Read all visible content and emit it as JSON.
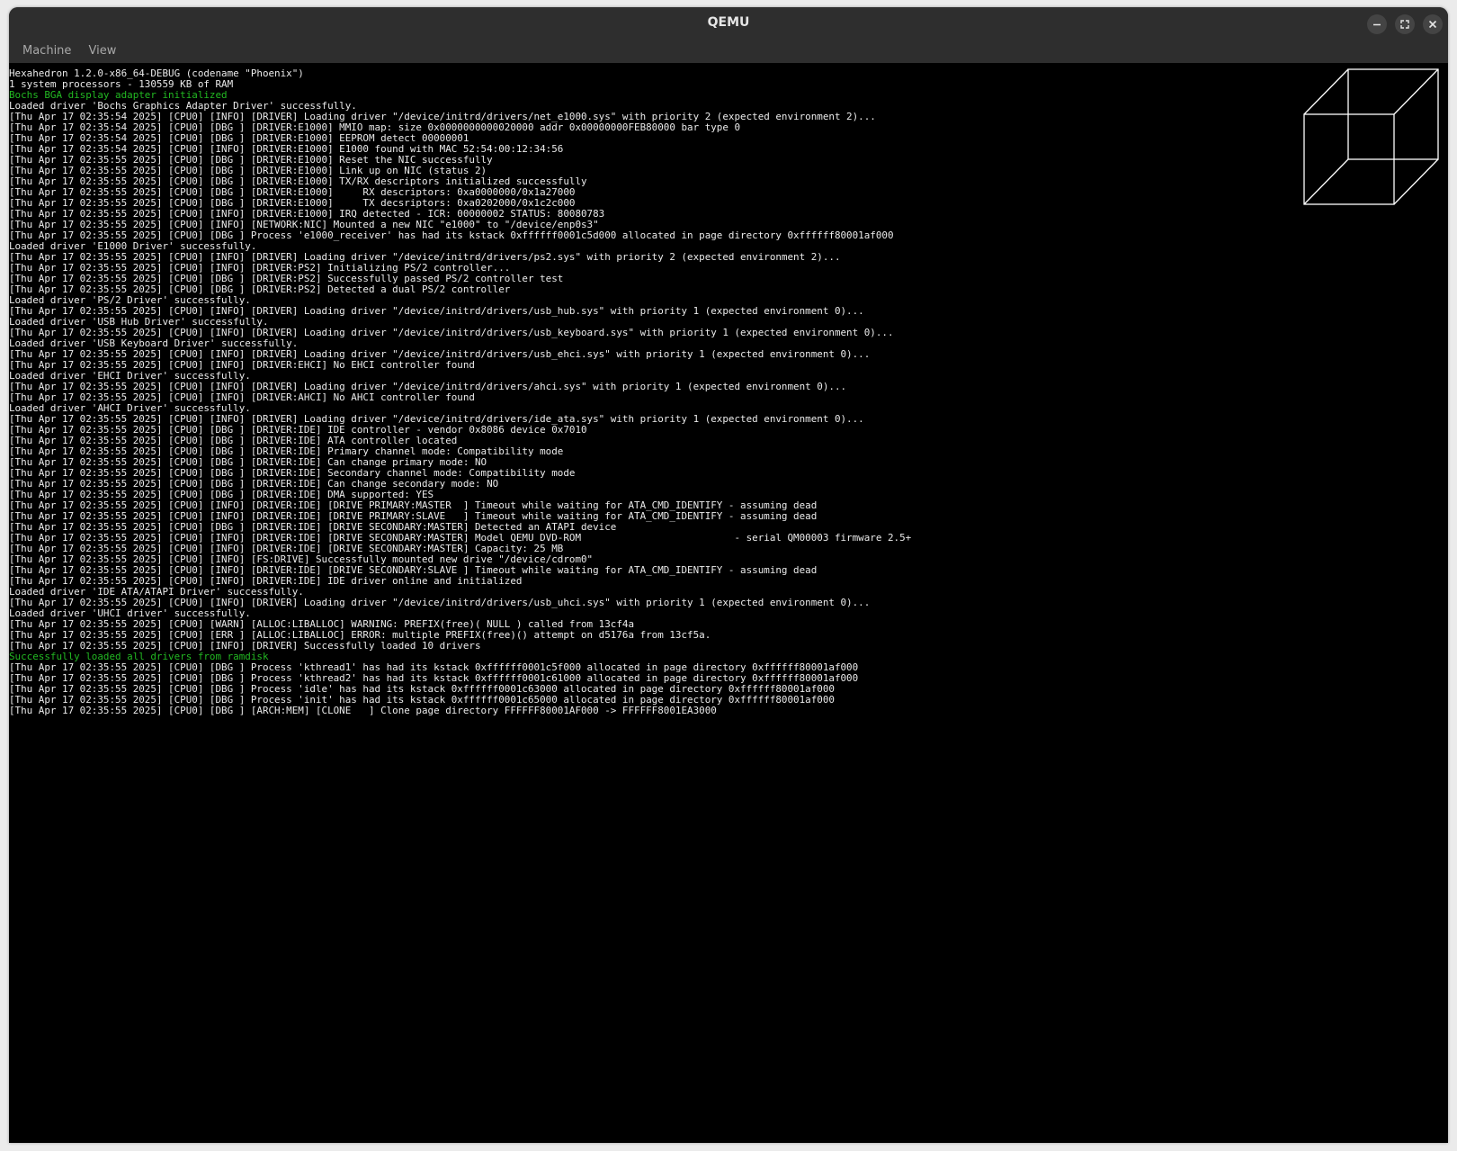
{
  "window": {
    "title": "QEMU"
  },
  "menubar": {
    "items": [
      "Machine",
      "View"
    ]
  },
  "colors": {
    "console_text": "#eaeaea",
    "console_highlight": "#22b822",
    "background": "#000000"
  },
  "icons": {
    "minimize": "minimize-icon",
    "maximize": "maximize-icon",
    "close": "close-icon",
    "cube": "wireframe-cube-graphic"
  },
  "console": {
    "lines": [
      {
        "t": "Hexahedron 1.2.0-x86_64-DEBUG (codename \"Phoenix\")"
      },
      {
        "t": "1 system processors - 130559 KB of RAM"
      },
      {
        "t": "Bochs BGA display adapter initialized",
        "c": "green"
      },
      {
        "t": "Loaded driver 'Bochs Graphics Adapter Driver' successfully."
      },
      {
        "t": "[Thu Apr 17 02:35:54 2025] [CPU0] [INFO] [DRIVER] Loading driver \"/device/initrd/drivers/net_e1000.sys\" with priority 2 (expected environment 2)..."
      },
      {
        "t": "[Thu Apr 17 02:35:54 2025] [CPU0] [DBG ] [DRIVER:E1000] MMIO map: size 0x0000000000020000 addr 0x00000000FEB80000 bar type 0"
      },
      {
        "t": "[Thu Apr 17 02:35:54 2025] [CPU0] [DBG ] [DRIVER:E1000] EEPROM detect 00000001"
      },
      {
        "t": "[Thu Apr 17 02:35:54 2025] [CPU0] [INFO] [DRIVER:E1000] E1000 found with MAC 52:54:00:12:34:56"
      },
      {
        "t": "[Thu Apr 17 02:35:55 2025] [CPU0] [DBG ] [DRIVER:E1000] Reset the NIC successfully"
      },
      {
        "t": "[Thu Apr 17 02:35:55 2025] [CPU0] [DBG ] [DRIVER:E1000] Link up on NIC (status 2)"
      },
      {
        "t": "[Thu Apr 17 02:35:55 2025] [CPU0] [DBG ] [DRIVER:E1000] TX/RX descriptors initialized successfully"
      },
      {
        "t": "[Thu Apr 17 02:35:55 2025] [CPU0] [DBG ] [DRIVER:E1000]     RX descriptors: 0xa0000000/0x1a27000"
      },
      {
        "t": "[Thu Apr 17 02:35:55 2025] [CPU0] [DBG ] [DRIVER:E1000]     TX decsriptors: 0xa0202000/0x1c2c000"
      },
      {
        "t": "[Thu Apr 17 02:35:55 2025] [CPU0] [INFO] [DRIVER:E1000] IRQ detected - ICR: 00000002 STATUS: 80080783"
      },
      {
        "t": "[Thu Apr 17 02:35:55 2025] [CPU0] [INFO] [NETWORK:NIC] Mounted a new NIC \"e1000\" to \"/device/enp0s3\""
      },
      {
        "t": "[Thu Apr 17 02:35:55 2025] [CPU0] [DBG ] Process 'e1000_receiver' has had its kstack 0xffffff0001c5d000 allocated in page directory 0xffffff80001af000"
      },
      {
        "t": "Loaded driver 'E1000 Driver' successfully."
      },
      {
        "t": "[Thu Apr 17 02:35:55 2025] [CPU0] [INFO] [DRIVER] Loading driver \"/device/initrd/drivers/ps2.sys\" with priority 2 (expected environment 2)..."
      },
      {
        "t": "[Thu Apr 17 02:35:55 2025] [CPU0] [INFO] [DRIVER:PS2] Initializing PS/2 controller..."
      },
      {
        "t": "[Thu Apr 17 02:35:55 2025] [CPU0] [DBG ] [DRIVER:PS2] Successfully passed PS/2 controller test"
      },
      {
        "t": "[Thu Apr 17 02:35:55 2025] [CPU0] [DBG ] [DRIVER:PS2] Detected a dual PS/2 controller"
      },
      {
        "t": "Loaded driver 'PS/2 Driver' successfully."
      },
      {
        "t": "[Thu Apr 17 02:35:55 2025] [CPU0] [INFO] [DRIVER] Loading driver \"/device/initrd/drivers/usb_hub.sys\" with priority 1 (expected environment 0)..."
      },
      {
        "t": "Loaded driver 'USB Hub Driver' successfully."
      },
      {
        "t": "[Thu Apr 17 02:35:55 2025] [CPU0] [INFO] [DRIVER] Loading driver \"/device/initrd/drivers/usb_keyboard.sys\" with priority 1 (expected environment 0)..."
      },
      {
        "t": "Loaded driver 'USB Keyboard Driver' successfully."
      },
      {
        "t": "[Thu Apr 17 02:35:55 2025] [CPU0] [INFO] [DRIVER] Loading driver \"/device/initrd/drivers/usb_ehci.sys\" with priority 1 (expected environment 0)..."
      },
      {
        "t": "[Thu Apr 17 02:35:55 2025] [CPU0] [INFO] [DRIVER:EHCI] No EHCI controller found"
      },
      {
        "t": "Loaded driver 'EHCI Driver' successfully."
      },
      {
        "t": "[Thu Apr 17 02:35:55 2025] [CPU0] [INFO] [DRIVER] Loading driver \"/device/initrd/drivers/ahci.sys\" with priority 1 (expected environment 0)..."
      },
      {
        "t": "[Thu Apr 17 02:35:55 2025] [CPU0] [INFO] [DRIVER:AHCI] No AHCI controller found"
      },
      {
        "t": "Loaded driver 'AHCI Driver' successfully."
      },
      {
        "t": "[Thu Apr 17 02:35:55 2025] [CPU0] [INFO] [DRIVER] Loading driver \"/device/initrd/drivers/ide_ata.sys\" with priority 1 (expected environment 0)..."
      },
      {
        "t": "[Thu Apr 17 02:35:55 2025] [CPU0] [DBG ] [DRIVER:IDE] IDE controller - vendor 0x8086 device 0x7010"
      },
      {
        "t": "[Thu Apr 17 02:35:55 2025] [CPU0] [DBG ] [DRIVER:IDE] ATA controller located"
      },
      {
        "t": "[Thu Apr 17 02:35:55 2025] [CPU0] [DBG ] [DRIVER:IDE] Primary channel mode: Compatibility mode"
      },
      {
        "t": "[Thu Apr 17 02:35:55 2025] [CPU0] [DBG ] [DRIVER:IDE] Can change primary mode: NO"
      },
      {
        "t": "[Thu Apr 17 02:35:55 2025] [CPU0] [DBG ] [DRIVER:IDE] Secondary channel mode: Compatibility mode"
      },
      {
        "t": "[Thu Apr 17 02:35:55 2025] [CPU0] [DBG ] [DRIVER:IDE] Can change secondary mode: NO"
      },
      {
        "t": "[Thu Apr 17 02:35:55 2025] [CPU0] [DBG ] [DRIVER:IDE] DMA supported: YES"
      },
      {
        "t": "[Thu Apr 17 02:35:55 2025] [CPU0] [INFO] [DRIVER:IDE] [DRIVE PRIMARY:MASTER  ] Timeout while waiting for ATA_CMD_IDENTIFY - assuming dead"
      },
      {
        "t": "[Thu Apr 17 02:35:55 2025] [CPU0] [INFO] [DRIVER:IDE] [DRIVE PRIMARY:SLAVE   ] Timeout while waiting for ATA_CMD_IDENTIFY - assuming dead"
      },
      {
        "t": "[Thu Apr 17 02:35:55 2025] [CPU0] [DBG ] [DRIVER:IDE] [DRIVE SECONDARY:MASTER] Detected an ATAPI device"
      },
      {
        "t": "[Thu Apr 17 02:35:55 2025] [CPU0] [INFO] [DRIVER:IDE] [DRIVE SECONDARY:MASTER] Model QEMU DVD-ROM                          - serial QM00003 firmware 2.5+"
      },
      {
        "t": "[Thu Apr 17 02:35:55 2025] [CPU0] [INFO] [DRIVER:IDE] [DRIVE SECONDARY:MASTER] Capacity: 25 MB"
      },
      {
        "t": "[Thu Apr 17 02:35:55 2025] [CPU0] [INFO] [FS:DRIVE] Successfully mounted new drive \"/device/cdrom0\""
      },
      {
        "t": "[Thu Apr 17 02:35:55 2025] [CPU0] [INFO] [DRIVER:IDE] [DRIVE SECONDARY:SLAVE ] Timeout while waiting for ATA_CMD_IDENTIFY - assuming dead"
      },
      {
        "t": "[Thu Apr 17 02:35:55 2025] [CPU0] [INFO] [DRIVER:IDE] IDE driver online and initialized"
      },
      {
        "t": "Loaded driver 'IDE ATA/ATAPI Driver' successfully."
      },
      {
        "t": "[Thu Apr 17 02:35:55 2025] [CPU0] [INFO] [DRIVER] Loading driver \"/device/initrd/drivers/usb_uhci.sys\" with priority 1 (expected environment 0)..."
      },
      {
        "t": "Loaded driver 'UHCI driver' successfully."
      },
      {
        "t": "[Thu Apr 17 02:35:55 2025] [CPU0] [WARN] [ALLOC:LIBALLOC] WARNING: PREFIX(free)( NULL ) called from 13cf4a"
      },
      {
        "t": "[Thu Apr 17 02:35:55 2025] [CPU0] [ERR ] [ALLOC:LIBALLOC] ERROR: multiple PREFIX(free)() attempt on d5176a from 13cf5a."
      },
      {
        "t": "[Thu Apr 17 02:35:55 2025] [CPU0] [INFO] [DRIVER] Successfully loaded 10 drivers"
      },
      {
        "t": "Successfully loaded all drivers from ramdisk",
        "c": "green"
      },
      {
        "t": "[Thu Apr 17 02:35:55 2025] [CPU0] [DBG ] Process 'kthread1' has had its kstack 0xffffff0001c5f000 allocated in page directory 0xffffff80001af000"
      },
      {
        "t": "[Thu Apr 17 02:35:55 2025] [CPU0] [DBG ] Process 'kthread2' has had its kstack 0xffffff0001c61000 allocated in page directory 0xffffff80001af000"
      },
      {
        "t": "[Thu Apr 17 02:35:55 2025] [CPU0] [DBG ] Process 'idle' has had its kstack 0xffffff0001c63000 allocated in page directory 0xffffff80001af000"
      },
      {
        "t": "[Thu Apr 17 02:35:55 2025] [CPU0] [DBG ] Process 'init' has had its kstack 0xffffff0001c65000 allocated in page directory 0xffffff80001af000"
      },
      {
        "t": "[Thu Apr 17 02:35:55 2025] [CPU0] [DBG ] [ARCH:MEM] [CLONE   ] Clone page directory FFFFFF80001AF000 -> FFFFFF8001EA3000"
      }
    ]
  }
}
